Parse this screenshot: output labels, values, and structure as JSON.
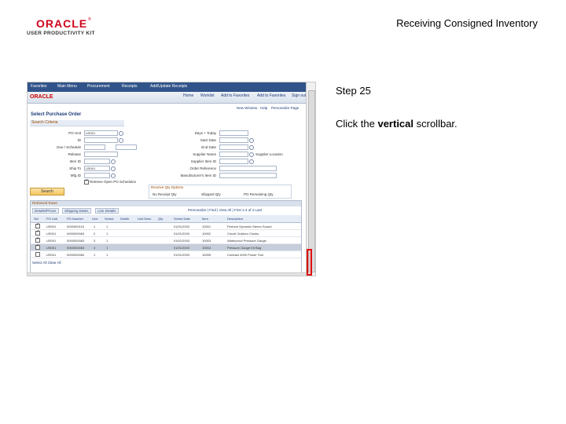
{
  "header": {
    "brand": "ORACLE",
    "brand_sub": "USER PRODUCTIVITY KIT",
    "doc_title": "Receiving Consigned Inventory"
  },
  "step": {
    "number": "Step 25",
    "instruction_prefix": "Click the ",
    "instruction_bold": "vertical",
    "instruction_suffix": " scrollbar."
  },
  "app": {
    "topnav": [
      "Favorites",
      "Main Menu",
      "Procurement",
      "Receipts",
      "Add/Update Receipts"
    ],
    "links": [
      "Home",
      "Worklist",
      "Add to Favorites",
      "Add to Favorites",
      "Sign out"
    ],
    "toolbar": [
      "New Window",
      "Help",
      "Personalize Page"
    ],
    "page_title": "Select Purchase Order",
    "search_section": "Search Criteria",
    "fields_left": [
      {
        "label": "PO Unit",
        "value": "US001"
      },
      {
        "label": "ID",
        "value": ""
      },
      {
        "label": "Due / Schedule",
        "value": ""
      },
      {
        "label": "Release",
        "value": ""
      },
      {
        "label": "Item ID",
        "value": ""
      },
      {
        "label": "Ship To",
        "value": "US001"
      },
      {
        "label": "Mfg ID",
        "value": ""
      }
    ],
    "fields_right": [
      {
        "label": "Days + Today",
        "value": ""
      },
      {
        "label": "Start Date",
        "value": ""
      },
      {
        "label": "End Date",
        "value": ""
      },
      {
        "label": "Supplier Name",
        "value": ""
      },
      {
        "label": "Supplier Item ID",
        "value": ""
      },
      {
        "label": "Order Reference",
        "value": ""
      },
      {
        "label": "Manufacturer's Item ID",
        "value": ""
      }
    ],
    "supplier_location": "Supplier Location",
    "retrieve_label": "Retrieve Open PO Schedules",
    "search_button": "Search",
    "receive_box_title": "Receive Qty Options",
    "receive_options": [
      "No Receipt Qty",
      "Shipped Qty",
      "PO Remaining Qty"
    ],
    "grid_title": "Retrieved Rows",
    "grid_tabs": [
      "Details/Prices",
      "Shipping Dates",
      "Line Details"
    ],
    "grid_nav": "Personalize | Find | View All | First 1-4 of 4 Last",
    "grid_columns": [
      "Sel",
      "PO Unit",
      "PO Number",
      "Line",
      "Sched",
      "Distrib",
      "Unit Desc",
      "Qty",
      "Sched Date",
      "Item",
      "Description"
    ],
    "grid_rows": [
      {
        "sel": true,
        "unit": "US001",
        "po": "0000000115",
        "line": "1",
        "sched": "1",
        "date": "01/01/2003",
        "item": "10001",
        "desc": "Perform Dynamic Stereo Sound"
      },
      {
        "sel": true,
        "unit": "US001",
        "po": "0000000063",
        "line": "2",
        "sched": "1",
        "date": "01/01/2003",
        "item": "10002",
        "desc": "Circuit Outdoor Clocks"
      },
      {
        "sel": true,
        "unit": "US001",
        "po": "0000000063",
        "line": "3",
        "sched": "1",
        "date": "01/01/2003",
        "item": "10003",
        "desc": "Waterproof Pressure Gauge"
      },
      {
        "sel": true,
        "unit": "US001",
        "po": "0000000063",
        "line": "4",
        "sched": "1",
        "date": "01/01/2003",
        "item": "10004",
        "desc": "Pressure Gauge Kit Bag"
      },
      {
        "sel": false,
        "unit": "US001",
        "po": "0000000084",
        "line": "1",
        "sched": "1",
        "date": "01/01/2003",
        "item": "10005",
        "desc": "Contract 4000 Power Tool"
      }
    ],
    "grid_footer": "Select All    Clear All"
  }
}
